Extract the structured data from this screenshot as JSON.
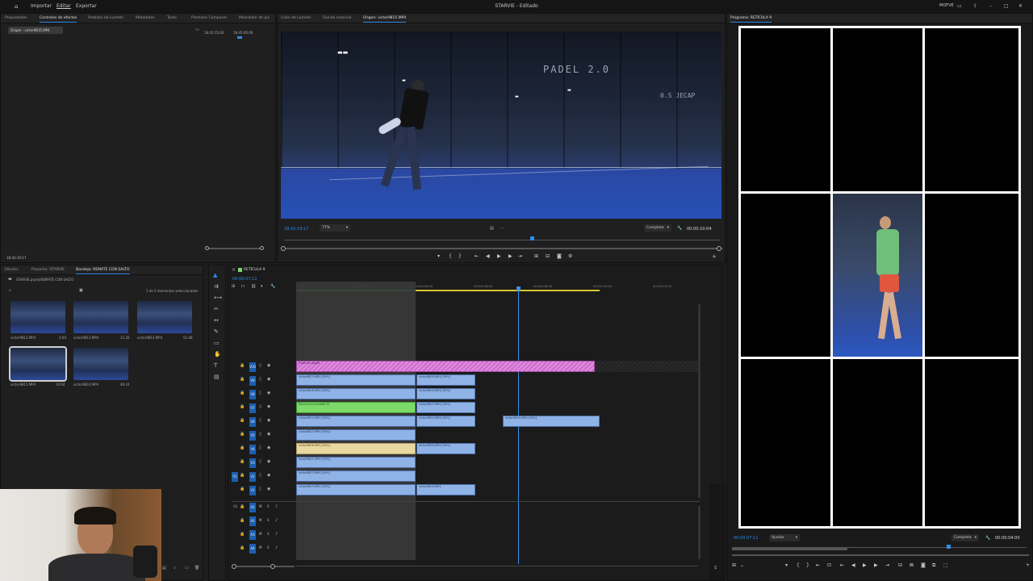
{
  "app": {
    "title": "STARVIE - Editado",
    "menu": [
      "Importar",
      "Editar",
      "Exportar"
    ],
    "workspace_label": "MOFVE"
  },
  "left_top_panel": {
    "tabs": [
      "Propiedades",
      "Controles de efectos",
      "Ámbitos de Lumetri",
      "Metadatos",
      "Texto",
      "Premiere Composer",
      "Mezclador de pis"
    ],
    "source_chip": "Origen - victor9815.MP4",
    "timecodes": [
      "18:43:15;00",
      "18:45:00;00"
    ],
    "bottom_timecode": "18:42:19:17"
  },
  "source_monitor": {
    "tabs": [
      "Color de Lumetri",
      "Sonido esencial",
      "Origen: victor9815.MP4"
    ],
    "timecode_left": "18:42:19:17",
    "zoom": "77%",
    "quality": "Completa",
    "timecode_right": "00:00:10:04",
    "logo_text": "PADEL 2.0",
    "logo_text_2": "0.S JECAP"
  },
  "program_monitor": {
    "title": "Programa: RETÍCULA 9",
    "timecode_left": "00:00:07:11",
    "fit": "Ajustar",
    "quality": "Completa",
    "timecode_right": "00:00:04:00"
  },
  "project_panel": {
    "tabs": [
      "Efectos",
      "Proyecto: STARVIE",
      "Bandeja: REMATE CON SALTO"
    ],
    "path": "STARVIE.prproj\\REMATE CON SALTO",
    "selection_info": "1 de 5 elementos seleccionados",
    "items": [
      {
        "name": "victor9812.MP4",
        "duration": "2:00"
      },
      {
        "name": "victor9813.MP4",
        "duration": "11:26"
      },
      {
        "name": "victor9814.MP4",
        "duration": "51:48"
      },
      {
        "name": "victor9815.MP4",
        "duration": "10:04"
      },
      {
        "name": "victor9816.MP4",
        "duration": "49:24"
      }
    ]
  },
  "timeline": {
    "sequence_name": "RETÍCULA 9",
    "timecode": "00:00:07:11",
    "ruler": [
      "00:00",
      "00:00:02:00",
      "00:00:04:00",
      "00:00:06:00",
      "00:00:08:00",
      "00:00:10:00",
      "00:00:12:00"
    ],
    "video_tracks": [
      "V10",
      "V9",
      "V8",
      "V7",
      "V6",
      "V5",
      "V4",
      "V3",
      "V2",
      "V1"
    ],
    "audio_tracks": [
      "A1",
      "A2",
      "A3",
      "A4"
    ],
    "source_patch": "V1",
    "adjustment_clip": "Capa de ajuste",
    "clips": [
      "victor9825.MP4 [50%]",
      "victor9818.MP4 [50%]",
      "victor9826.MP4 [50%]",
      "victor9818.MP4 [50%]",
      "Secuencia anidada 01",
      "victor9815.MP4 [50%]",
      "victor9814.MP4 [50%]",
      "victor9815.MP4 [50%]",
      "victor9824.MP4 [50%]",
      "victor9823.MP4 [50%]",
      "victor9806.MP4 [50%]",
      "victor9816.MP4 [50%]",
      "victor9821.MP4 [50%]",
      "victor9820.MP4 [50%]",
      "victor9819.MP4 [50%]",
      "victor9818.MP4"
    ]
  },
  "colors": {
    "accent": "#2d8ceb",
    "clip_blue": "#8fb3e6",
    "clip_green": "#7dd96a",
    "clip_pink": "#d98ad9",
    "clip_yellow": "#e8d9a2"
  }
}
